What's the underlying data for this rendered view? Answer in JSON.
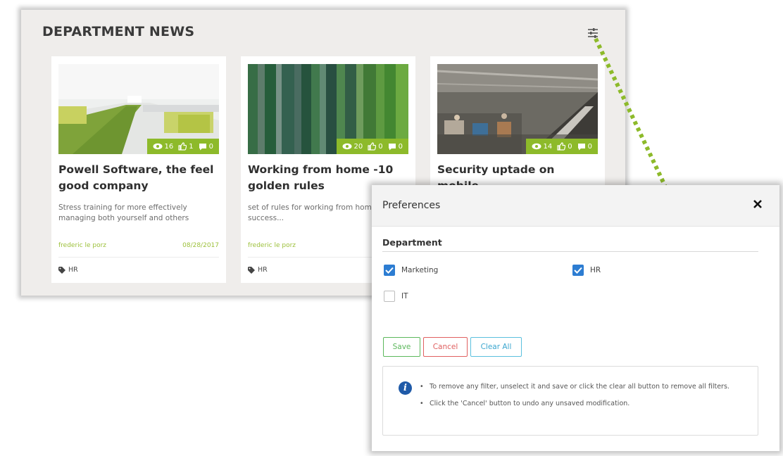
{
  "panel": {
    "title": "DEPARTMENT NEWS"
  },
  "cards": [
    {
      "title": "Powell Software, the feel good company",
      "description": "Stress training for more effectively managing both yourself and others",
      "author": "frederic le porz",
      "date": "08/28/2017",
      "tag": "HR",
      "views": "16",
      "likes": "1",
      "comments": "0"
    },
    {
      "title": "Working from home -10 golden rules",
      "description": "set of rules for working from home with success...",
      "author": "frederic le porz",
      "date": "",
      "tag": "HR",
      "views": "20",
      "likes": "0",
      "comments": "0"
    },
    {
      "title": "Security uptade on mobile",
      "description": "",
      "author": "",
      "date": "",
      "tag": "",
      "views": "14",
      "likes": "0",
      "comments": "0"
    }
  ],
  "modal": {
    "title": "Preferences",
    "section": "Department",
    "options": [
      {
        "label": "Marketing",
        "checked": true
      },
      {
        "label": "HR",
        "checked": true
      },
      {
        "label": "IT",
        "checked": false
      }
    ],
    "buttons": {
      "save": "Save",
      "cancel": "Cancel",
      "clear_all": "Clear All"
    },
    "info": [
      "To remove any filter, unselect it and save or click the clear all button to remove all filters.",
      "Click the 'Cancel' button to undo any unsaved modification."
    ]
  },
  "colors": {
    "accent_green": "#8dba2a",
    "checkbox_blue": "#2d7dd2",
    "save_green": "#5cb85c",
    "cancel_red": "#e06060",
    "clear_blue": "#5bc0de",
    "info_blue": "#1f5aa8"
  },
  "icons": {
    "filter": "filter-sliders-icon",
    "close": "close-icon",
    "views": "eye-icon",
    "likes": "thumbs-up-icon",
    "comments": "comment-icon",
    "tag": "tag-icon",
    "info": "info-icon"
  }
}
